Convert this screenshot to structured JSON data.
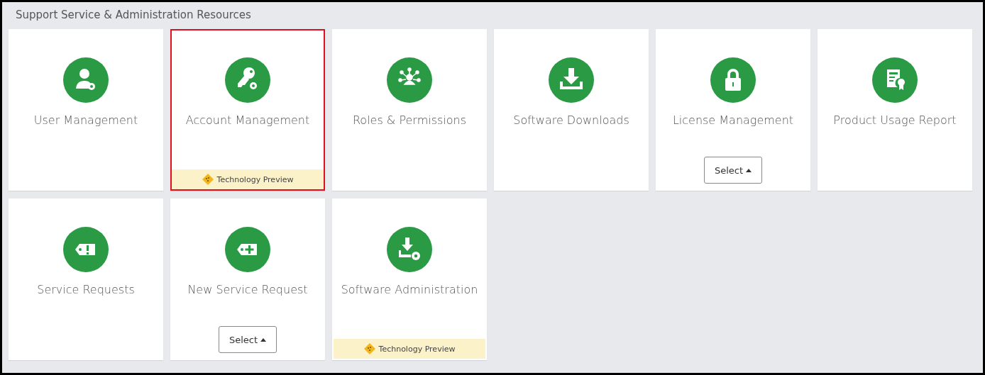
{
  "section": {
    "title": "Support Service & Administration Resources"
  },
  "tiles": [
    {
      "title": "User Management",
      "selected": false
    },
    {
      "title": "Account Management",
      "selected": true,
      "footer": "Technology Preview"
    },
    {
      "title": "Roles & Permissions",
      "selected": false
    },
    {
      "title": "Software Downloads",
      "selected": false
    },
    {
      "title": "License Management",
      "selected": false,
      "button": "Select"
    },
    {
      "title": "Product Usage Report",
      "selected": false
    },
    {
      "title": "Service Requests",
      "selected": false
    },
    {
      "title": "New Service Request",
      "selected": false,
      "button": "Select"
    },
    {
      "title": "Software Administration",
      "selected": false,
      "footer": "Technology Preview"
    }
  ]
}
